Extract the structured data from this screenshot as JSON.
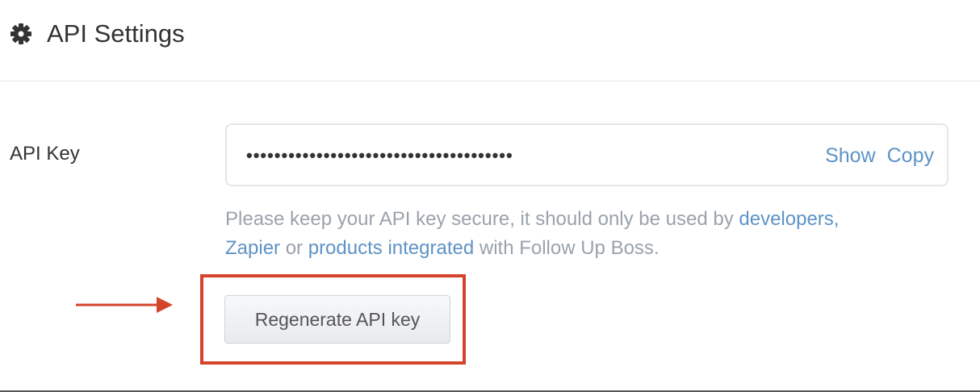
{
  "header": {
    "title": "API Settings",
    "icon": "gear-icon"
  },
  "api_key": {
    "label": "API Key",
    "value": "••••••••••••••••••••••••••••••••••••••",
    "show_label": "Show",
    "copy_label": "Copy"
  },
  "helper": {
    "text_1": "Please keep your API key secure, it should only be used by ",
    "link_developers": "developers,",
    "link_zapier": "Zapier",
    "text_2": " or ",
    "link_products": "products integrated",
    "text_3": " with Follow Up Boss."
  },
  "regenerate_button_label": "Regenerate API key",
  "colors": {
    "link": "#5e93c5",
    "highlight": "#d4442c",
    "helper_text": "#9aa2ab"
  }
}
